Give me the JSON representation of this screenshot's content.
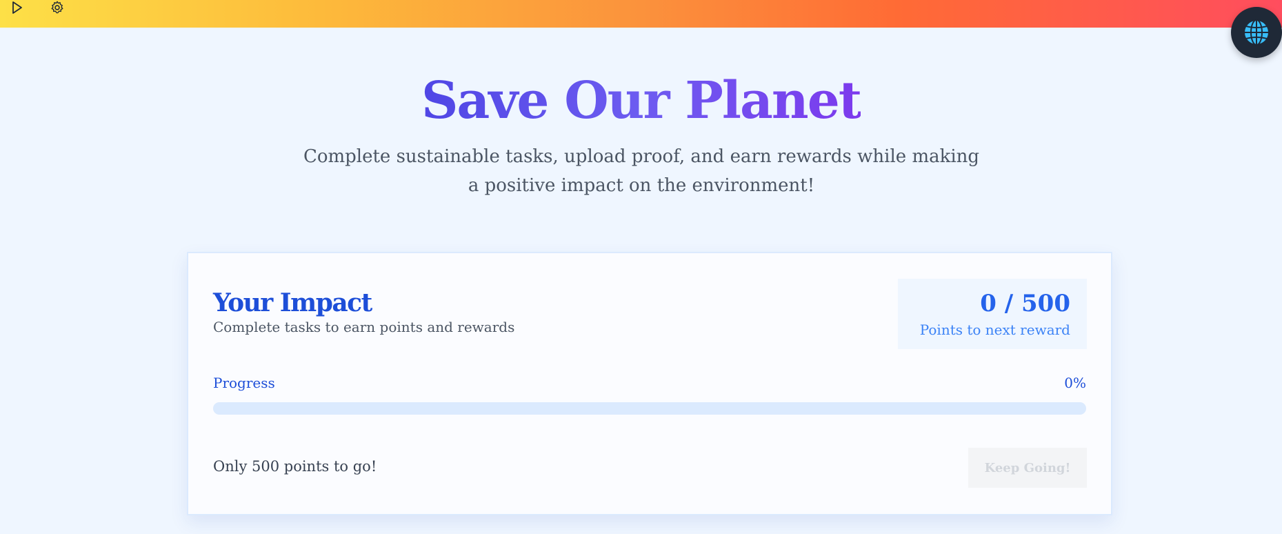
{
  "icons": {
    "play": "play-icon",
    "settings": "gear-icon",
    "globe": "globe-icon"
  },
  "colors": {
    "topbar_gradient": [
      "#fde047",
      "#fb923c",
      "#ff4d5e"
    ],
    "title_gradient": [
      "#4f46e5",
      "#7c3aed"
    ],
    "accent": "#2563eb",
    "background": "#eff6ff"
  },
  "hero": {
    "title": "Save Our Planet",
    "subtitle": "Complete sustainable tasks, upload proof, and earn rewards while making a positive impact on the environment!"
  },
  "impact": {
    "title": "Your Impact",
    "subtitle": "Complete tasks to earn points and rewards",
    "points_value": "0 / 500",
    "points_label": "Points to next reward",
    "progress_label": "Progress",
    "progress_percent_text": "0%",
    "progress_fraction": 0,
    "remaining_text": "Only 500 points to go!",
    "button_label": "Keep Going!"
  }
}
